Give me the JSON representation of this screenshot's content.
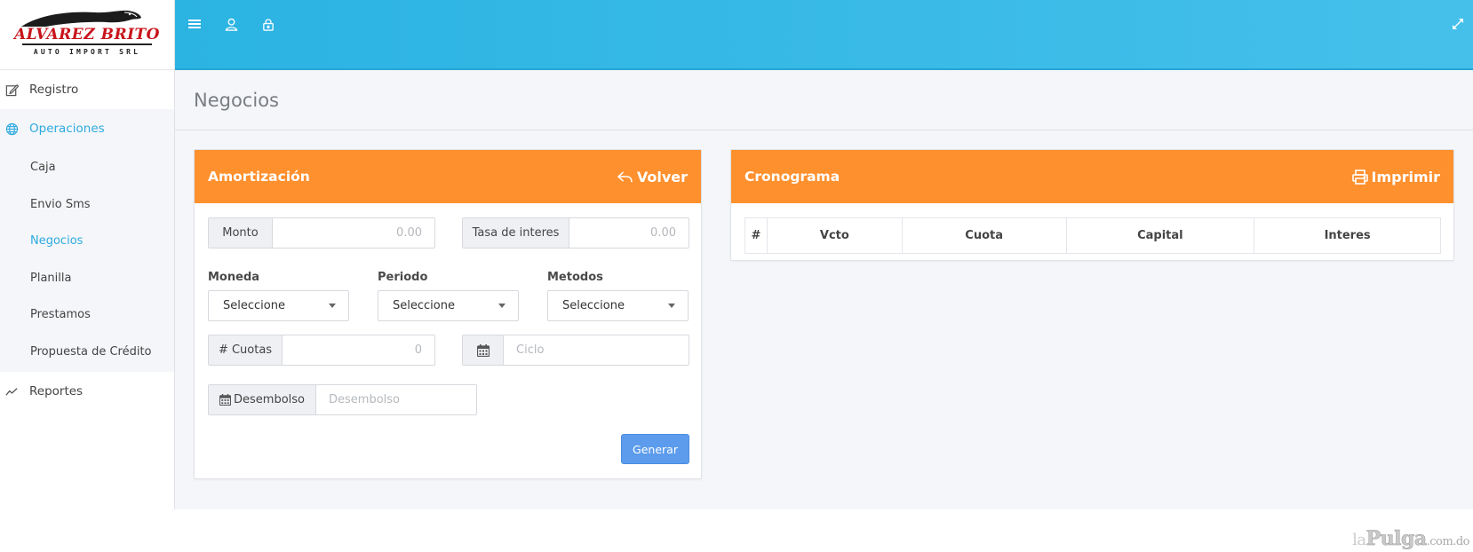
{
  "brand": {
    "name": "ALVAREZ BRITO",
    "subtitle": "AUTO IMPORT SRL",
    "color": "#c8141b"
  },
  "sidebar": {
    "items": [
      {
        "label": "Registro",
        "icon": "edit-icon"
      },
      {
        "label": "Operaciones",
        "icon": "globe-icon",
        "active": true
      },
      {
        "label": "Reportes",
        "icon": "line-chart-icon"
      }
    ],
    "submenu": [
      {
        "label": "Caja"
      },
      {
        "label": "Envio Sms"
      },
      {
        "label": "Negocios",
        "active": true
      },
      {
        "label": "Planilla"
      },
      {
        "label": "Prestamos"
      },
      {
        "label": "Propuesta de Crédito"
      }
    ]
  },
  "topbar": {
    "icons": [
      "menu-icon",
      "user-icon",
      "lock-icon",
      "expand-icon"
    ]
  },
  "page": {
    "title": "Negocios"
  },
  "amortizacion": {
    "title": "Amortización",
    "back_label": "Volver",
    "monto": {
      "label": "Monto",
      "placeholder": "0.00"
    },
    "tasa": {
      "label": "Tasa de interes",
      "placeholder": "0.00"
    },
    "moneda": {
      "label": "Moneda",
      "value": "Seleccione"
    },
    "periodo": {
      "label": "Periodo",
      "value": "Seleccione"
    },
    "metodos": {
      "label": "Metodos",
      "value": "Seleccione"
    },
    "cuotas": {
      "label": "# Cuotas",
      "placeholder": "0"
    },
    "ciclo": {
      "placeholder": "Ciclo"
    },
    "desembolso": {
      "label": "Desembolso",
      "placeholder": "Desembolso"
    },
    "generate_label": "Generar"
  },
  "cronograma": {
    "title": "Cronograma",
    "print_label": "Imprimir",
    "columns": [
      "#",
      "Vcto",
      "Cuota",
      "Capital",
      "Interes"
    ]
  },
  "watermark": {
    "prefix": "la",
    "main": "Pulga",
    "suffix": ".com.do"
  },
  "colors": {
    "accent": "#2eaadf",
    "panel_header": "#ff902e",
    "button": "#5d9cec"
  }
}
